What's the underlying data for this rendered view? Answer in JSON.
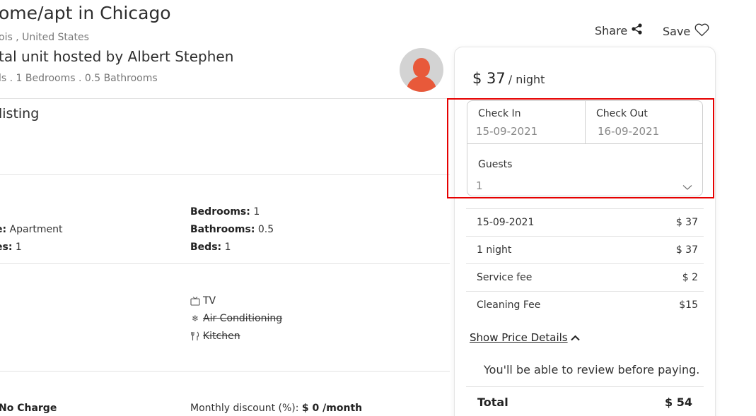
{
  "listing": {
    "title": "ome/apt in Chicago",
    "location": "ois , United States",
    "hosted_by": "tal unit hosted by Albert Stephen",
    "specs": "ls . 1 Bedrooms . 0.5 Bathrooms",
    "section_heading": "listing"
  },
  "actions": {
    "share_label": "Share",
    "save_label": "Save"
  },
  "details": {
    "left": [
      {
        "label": "",
        "value": ""
      },
      {
        "label": "e:",
        "value": "Apartment"
      },
      {
        "label": "es:",
        "value": "1"
      }
    ],
    "right": [
      {
        "label": "Bedrooms:",
        "value": "1"
      },
      {
        "label": "Bathrooms:",
        "value": "0.5"
      },
      {
        "label": "Beds:",
        "value": "1"
      }
    ]
  },
  "amenities": [
    {
      "icon": "tv-icon",
      "label": "TV",
      "available": true
    },
    {
      "icon": "snowflake-icon",
      "label": "Air Conditioning",
      "available": false
    },
    {
      "icon": "utensils-icon",
      "label": "Kitchen",
      "available": false
    }
  ],
  "fees": {
    "left_label": "No Charge",
    "monthly_label": "Monthly discount (%):",
    "monthly_value": "$ 0 /month"
  },
  "booking": {
    "price": "$ 37",
    "price_unit": "/ night",
    "check_in_label": "Check In",
    "check_in_value": "15-09-2021",
    "check_out_label": "Check Out",
    "check_out_value": "16-09-2021",
    "guests_label": "Guests",
    "guests_value": "1",
    "price_rows": [
      {
        "label": "15-09-2021",
        "value": "$ 37"
      },
      {
        "label": "1 night",
        "value": "$ 37"
      },
      {
        "label": "Service fee",
        "value": "$ 2"
      },
      {
        "label": "Cleaning Fee",
        "value": "$15"
      }
    ],
    "show_details_label": "Show Price Details",
    "review_note": "You'll be able to review before paying.",
    "total_label": "Total",
    "total_value": "$ 54"
  },
  "colors": {
    "highlight": "#e60000",
    "avatar_accent": "#e8593a"
  }
}
